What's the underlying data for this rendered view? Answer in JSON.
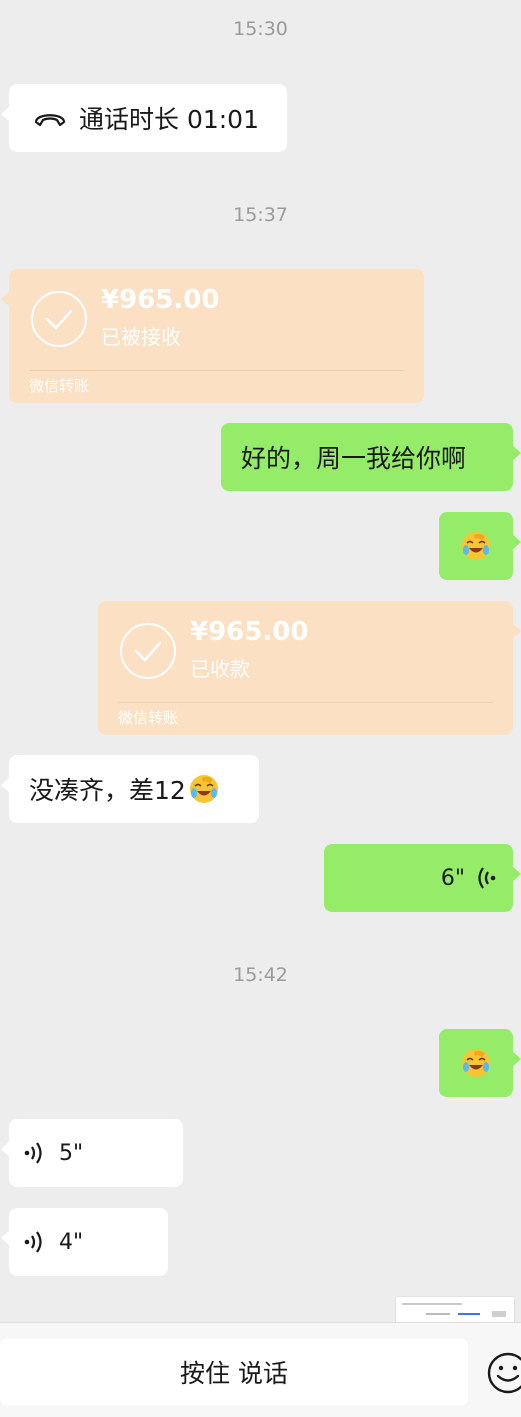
{
  "timestamps": [
    "15:30",
    "15:37",
    "15:42"
  ],
  "call_record": {
    "label": "通话时长 01:01",
    "icon": "hang-up-phone-icon"
  },
  "transfer_received": {
    "amount": "¥965.00",
    "status": "已被接收",
    "footer": "微信转账"
  },
  "reply_text": "好的，周一我给你啊",
  "emoji_reaction": "facepalm-laugh-emoji",
  "transfer_sent": {
    "amount": "¥965.00",
    "status": "已收款",
    "footer": "微信转账"
  },
  "incoming_text": {
    "text": "没凑齐，差12",
    "emoji": "facepalm-laugh-emoji"
  },
  "voice_sent": {
    "duration": "6\"",
    "icon": "voice-wave-icon"
  },
  "voice_received_1": {
    "duration": "5\"",
    "icon": "voice-wave-icon"
  },
  "voice_received_2": {
    "duration": "4\"",
    "icon": "voice-wave-icon"
  },
  "input_bar": {
    "hold_to_talk": "按住 说话",
    "emoji_icon": "smile-icon"
  },
  "colors": {
    "background": "#ededed",
    "incoming_bubble": "#ffffff",
    "outgoing_bubble": "#95ec69",
    "transfer_card": "#fbe0c4"
  }
}
